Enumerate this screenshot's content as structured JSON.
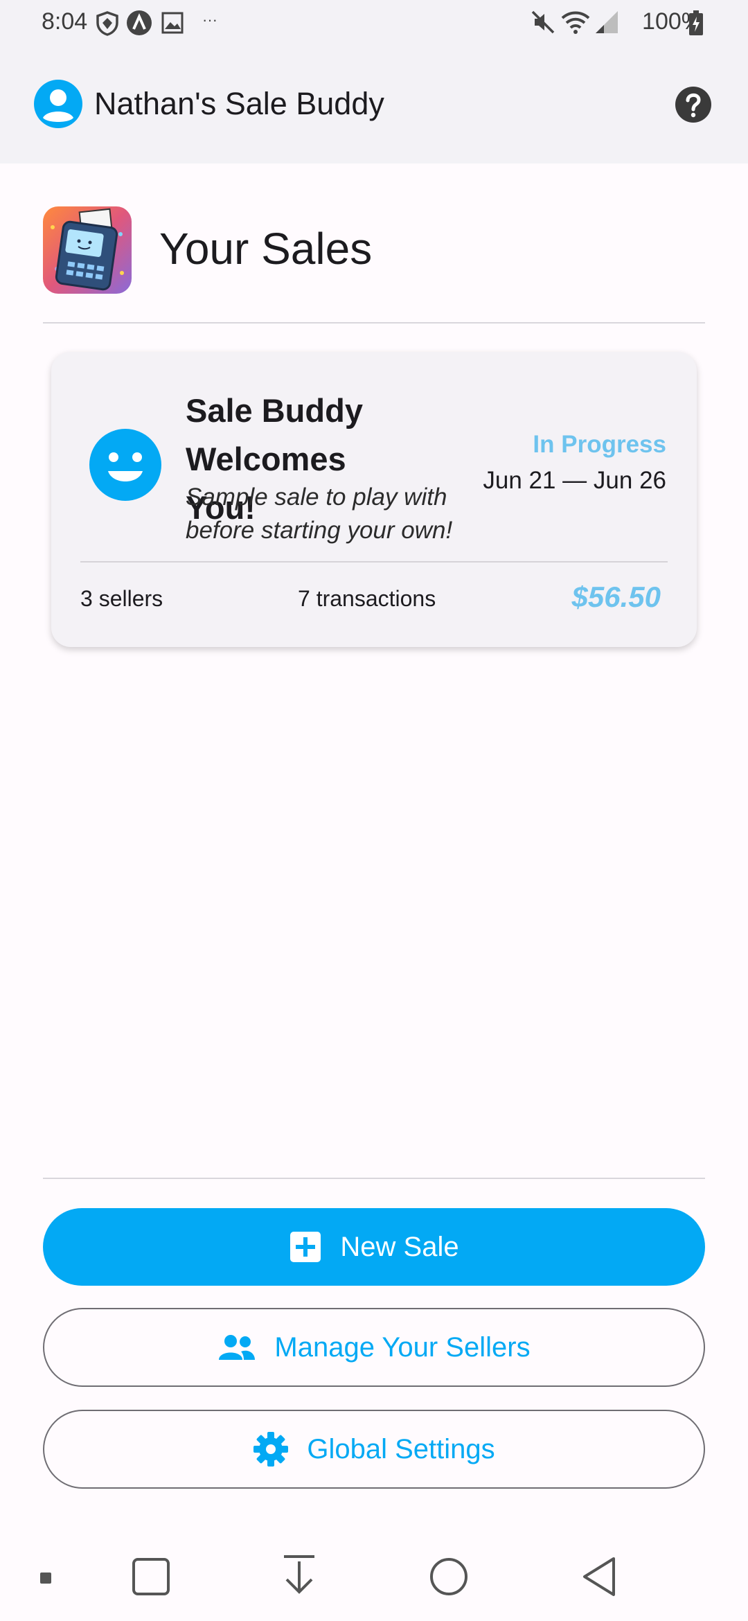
{
  "status_bar": {
    "time": "8:04",
    "battery": "100%",
    "icons": [
      "shield-icon",
      "app-a-icon",
      "image-icon",
      "more-dots-icon",
      "mute-icon",
      "wifi-icon",
      "signal-icon",
      "battery-icon"
    ]
  },
  "app_bar": {
    "title": "Nathan's Sale Buddy",
    "icons": [
      "account-icon",
      "help-icon"
    ]
  },
  "page": {
    "title": "Your Sales"
  },
  "sales": [
    {
      "title": "Sale Buddy Welcomes You!",
      "subtitle": "Sample sale to play with before starting your own!",
      "status": "In Progress",
      "dates": "Jun 21 — Jun 26",
      "sellers": "3 sellers",
      "transactions": "7 transactions",
      "total": "$56.50",
      "icon": "smiley-icon"
    }
  ],
  "actions": {
    "new_sale": "New Sale",
    "manage_sellers": "Manage Your Sellers",
    "global_settings": "Global Settings"
  },
  "colors": {
    "accent": "#03a9f4",
    "status_text": "#6ec3ee",
    "background": "#fffbfe",
    "appbar": "#f3f2f6"
  }
}
